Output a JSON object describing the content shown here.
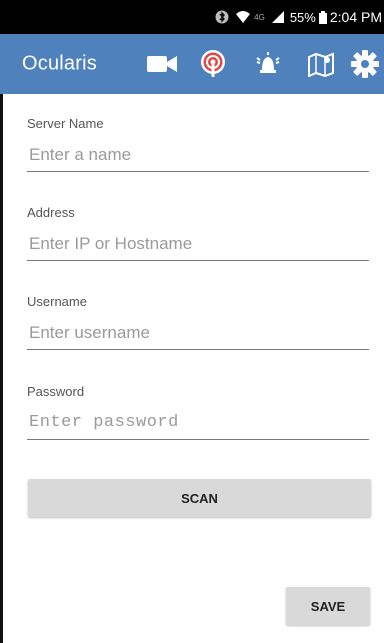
{
  "status_bar": {
    "battery_text": "55%",
    "time": "2:04 PM",
    "network_label": "4G"
  },
  "app_bar": {
    "title": "Ocularis",
    "actions": [
      {
        "name": "camera-icon"
      },
      {
        "name": "broadcast-icon"
      },
      {
        "name": "alarm-icon"
      },
      {
        "name": "map-icon"
      },
      {
        "name": "gear-icon"
      }
    ],
    "color": "#4f81bd"
  },
  "form": {
    "server_name": {
      "label": "Server Name",
      "placeholder": "Enter a name",
      "value": ""
    },
    "address": {
      "label": "Address",
      "placeholder": "Enter IP or Hostname",
      "value": ""
    },
    "username": {
      "label": "Username",
      "placeholder": "Enter username",
      "value": ""
    },
    "password": {
      "label": "Password",
      "placeholder": "Enter password",
      "value": ""
    }
  },
  "buttons": {
    "scan_label": "SCAN",
    "save_label": "SAVE"
  }
}
